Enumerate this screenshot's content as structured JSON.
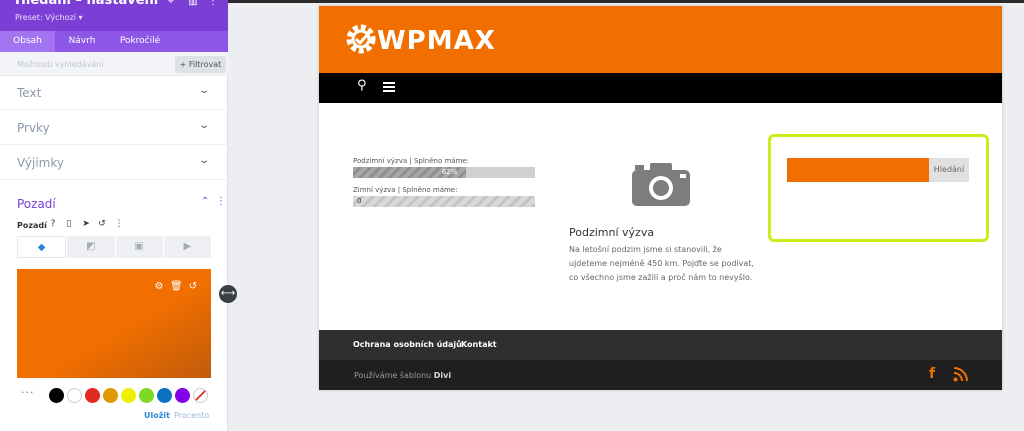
{
  "panel": {
    "title": "Hledání – nastavení",
    "preset": "Preset: Výchozí ▾",
    "tabs": [
      "Obsah",
      "Návrh",
      "Pokročilé"
    ],
    "search_placeholder": "Možnosti vyhledávání",
    "filter_label": "+ Filtrovat",
    "sections": [
      "Text",
      "Prvky",
      "Výjimky"
    ],
    "background": {
      "title": "Pozadí",
      "label": "Pozadí",
      "preview_color": "#f06f00"
    },
    "swatches": [
      "#000000",
      "#ffffff",
      "#e02b20",
      "#e09900",
      "#edf000",
      "#7cda24",
      "#0c71c3",
      "#8300e9"
    ],
    "save_label": "Uložit",
    "reset_label": "Procento"
  },
  "site": {
    "logo_text": "WPMAX",
    "accent": "#f06f00",
    "progress": [
      {
        "label": "Podzimní výzva | Splněno máme:",
        "value": 62,
        "pct_text": "62%"
      },
      {
        "label": "Zimní výzva | Splněno máme:",
        "value": 0,
        "pct_text": "0"
      }
    ],
    "card": {
      "title": "Podzimní výzva",
      "body": "Na letošní podzim jsme si stanovili, že ujdeteme nejméně 450 km. Pojďte se podívat, co všechno jsme zažili a proč nám to nevyšlo."
    },
    "search_button": "Hledání",
    "footer_links": [
      "Ochrana osobních údajů",
      "Kontakt"
    ],
    "credit_prefix": "Používáme šablonu ",
    "credit_brand": "Divi",
    "highlight_color": "#c8f018"
  }
}
